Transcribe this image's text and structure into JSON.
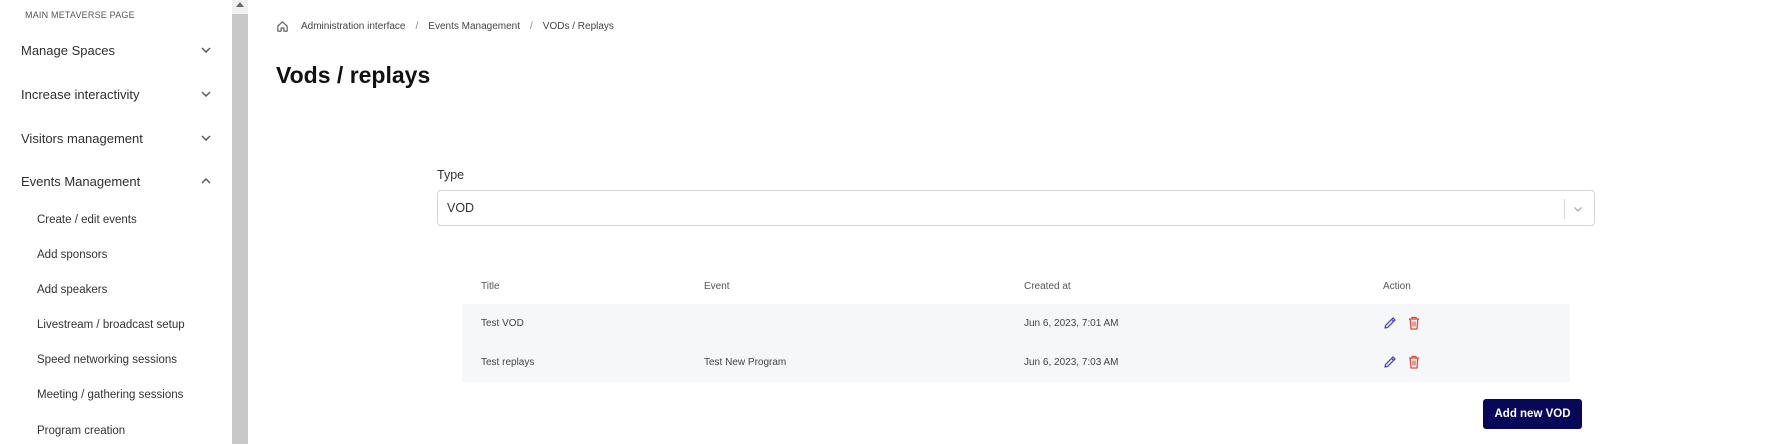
{
  "sidebar": {
    "section_label": "MAIN METAVERSE PAGE",
    "groups": [
      {
        "label": "Manage Spaces",
        "expanded": false
      },
      {
        "label": "Increase interactivity",
        "expanded": false
      },
      {
        "label": "Visitors management",
        "expanded": false
      },
      {
        "label": "Events Management",
        "expanded": true
      }
    ],
    "sub_items": [
      "Create / edit events",
      "Add sponsors",
      "Add speakers",
      "Livestream / broadcast setup",
      "Speed networking sessions",
      "Meeting / gathering sessions",
      "Program creation"
    ]
  },
  "breadcrumb": {
    "items": [
      "Administration interface",
      "Events Management",
      "VODs / Replays"
    ],
    "separator": "/"
  },
  "page": {
    "title": "Vods / replays"
  },
  "filter": {
    "type_label": "Type",
    "type_value": "VOD"
  },
  "table": {
    "columns": [
      "Title",
      "Event",
      "Created at",
      "Action"
    ],
    "rows": [
      {
        "title": "Test VOD",
        "event": "",
        "created_at": "Jun 6, 2023, 7:01 AM"
      },
      {
        "title": "Test replays",
        "event": "Test New Program",
        "created_at": "Jun 6, 2023, 7:03 AM"
      }
    ]
  },
  "buttons": {
    "add_new": "Add new VOD"
  },
  "colors": {
    "primary_button": "#07085a",
    "edit_icon": "#4b45c6",
    "delete_icon": "#e04a3c",
    "row_background": "#f6f7f8"
  },
  "icons": {
    "home": "home-icon",
    "edit": "pencil-icon",
    "delete": "trash-icon",
    "chevron": "chevron-icon"
  }
}
